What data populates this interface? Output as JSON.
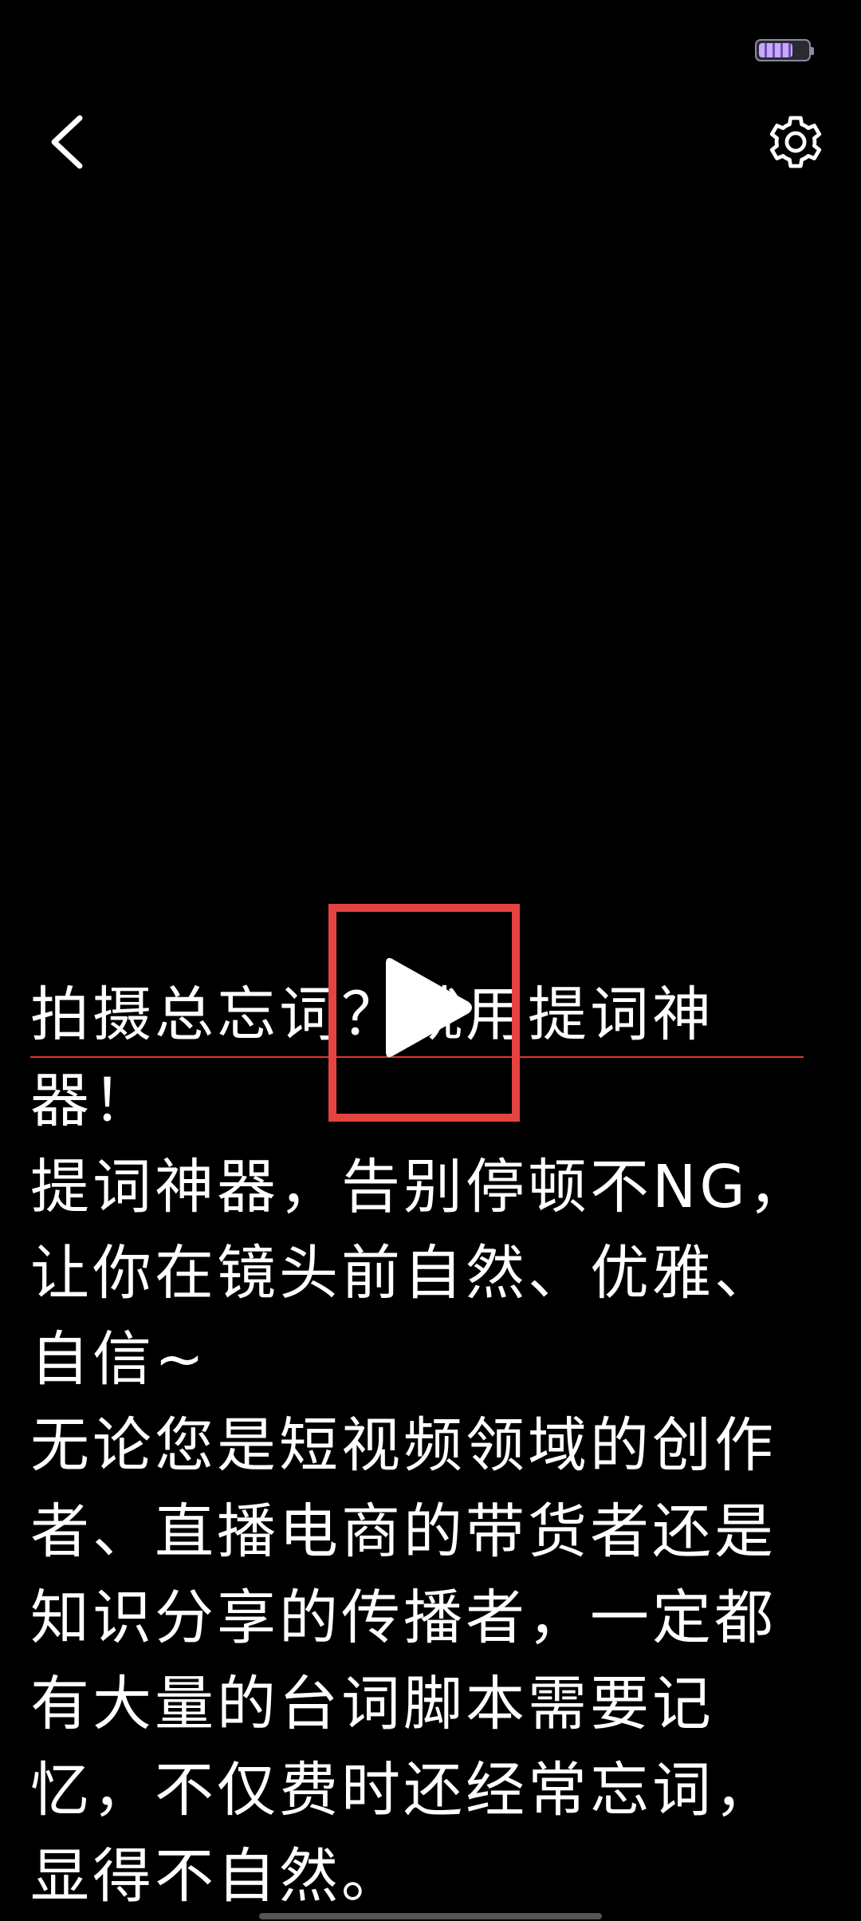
{
  "status_bar": {
    "battery_level": 0.7,
    "battery_color": "#c9a8ff"
  },
  "toolbar": {
    "back_icon": "chevron-left-icon",
    "settings_icon": "gear-icon"
  },
  "script": {
    "paragraphs": [
      "拍摄总忘词？就用提词神器！",
      "提词神器，告别停顿不NG，让你在镜头前自然、优雅、自信~",
      "无论您是短视频领域的创作者、直播电商的带货者还是知识分享的传播者，一定都有大量的台词脚本需要记忆，不仅费时还经常忘词，显得不自然。"
    ]
  },
  "overlay": {
    "play_icon": "play-icon",
    "highlight_color": "#e5433f",
    "guide_line_color": "#e1352e"
  }
}
